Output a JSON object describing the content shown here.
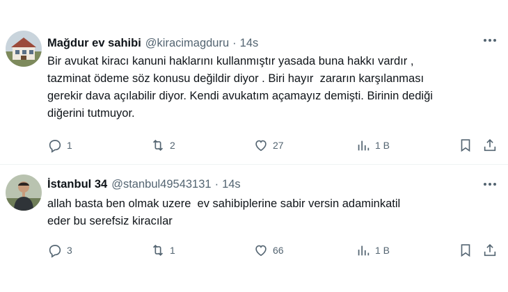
{
  "tweets": [
    {
      "name": "Mağdur ev sahibi",
      "handle": "@kiracimagduru",
      "separator": "·",
      "time": "14s",
      "text": "Bir avukat kiracı kanuni haklarını kullanmıştır yasada buna hakkı vardır ,\ntazminat ödeme söz konusu değildir diyor . Biri hayır  zararın karşılanması\ngerekir dava açılabilir diyor. Kendi avukatım açamayız demişti. Birinin dediği\ndiğerini tutmuyor.",
      "replies": "1",
      "reposts": "2",
      "likes": "27",
      "views": "1 B"
    },
    {
      "name": "İstanbul 34",
      "handle": "@stanbul49543131",
      "separator": "·",
      "time": "14s",
      "text": "allah basta ben olmak uzere  ev sahibiplerine sabir versin adaminkatil\neder bu serefsiz kiracılar",
      "replies": "3",
      "reposts": "1",
      "likes": "66",
      "views": "1 B"
    }
  ],
  "colors": {
    "text": "#0f1419",
    "secondary": "#536471",
    "divider": "#eff3f4"
  },
  "icons": [
    "more-icon",
    "reply-icon",
    "repost-icon",
    "like-icon",
    "views-icon",
    "bookmark-icon",
    "share-icon"
  ]
}
